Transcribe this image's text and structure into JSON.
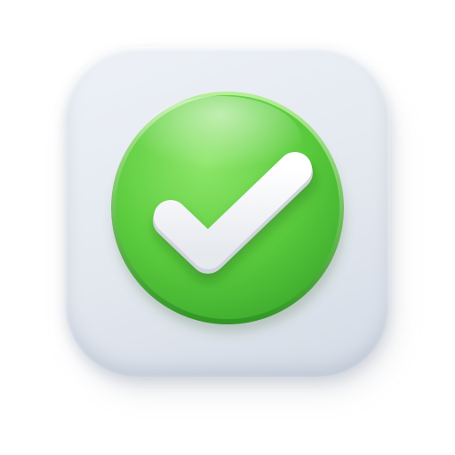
{
  "icon": {
    "tile": "rounded-square-tile",
    "symbol": "checkmark-icon",
    "status": "success"
  },
  "colors": {
    "background": "#ffffff",
    "tile": "#e6eaf0",
    "circle_light": "#8ee66a",
    "circle_mid": "#5ccc3e",
    "circle_dark": "#3aa82b",
    "check": "#ffffff"
  }
}
